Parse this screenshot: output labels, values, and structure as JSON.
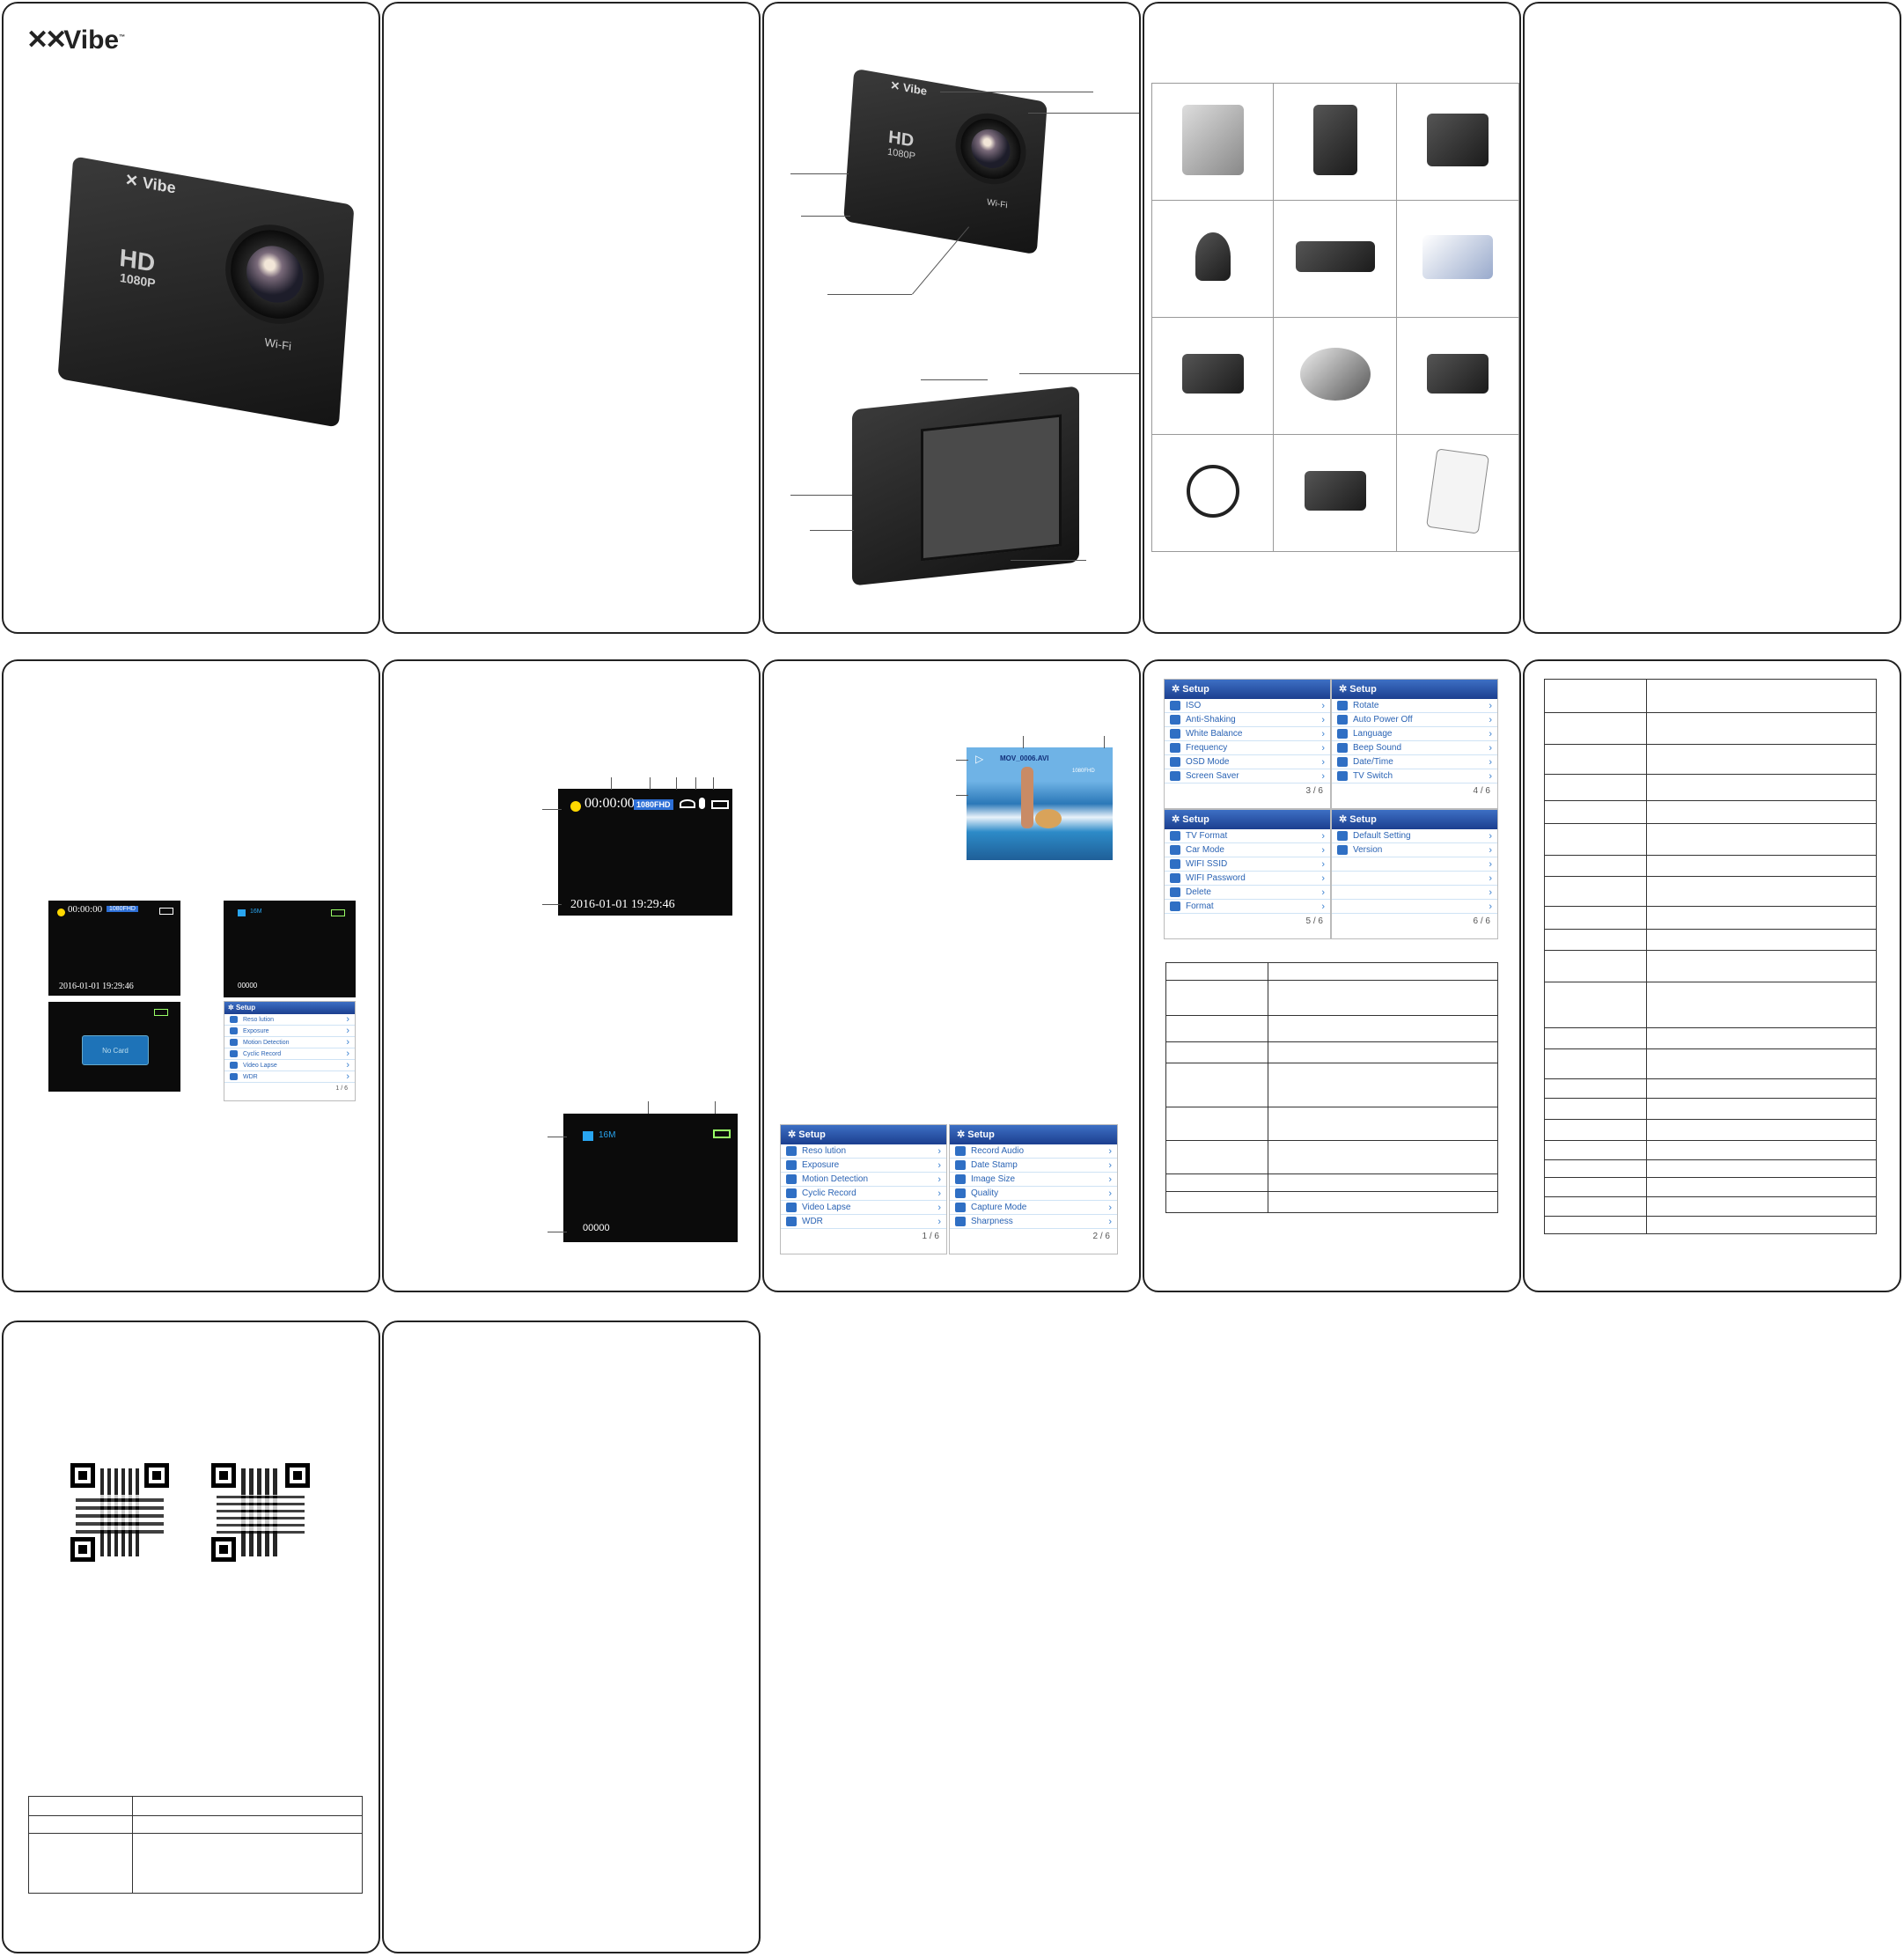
{
  "brand": {
    "name": "Vibe",
    "tm": "™"
  },
  "camera_front": {
    "hd": "HD",
    "res": "1080P",
    "wifi": "Wi-Fi"
  },
  "camera_diagram": {
    "hd": "HD",
    "res": "1080P",
    "wifi": "Wi-Fi"
  },
  "osd_video": {
    "timer": "00:00:00",
    "resolution": "1080FHD",
    "datetime": "2016-01-01  19:29:46"
  },
  "osd_photo": {
    "size": "16M",
    "count": "00000"
  },
  "no_card": {
    "text": "No Card"
  },
  "playback": {
    "filename": "MOV_0006.AVI",
    "res": "1080FHD"
  },
  "setup_title": "Setup",
  "menus": {
    "p1": {
      "items": [
        "Reso lution",
        "Exposure",
        "Motion Detection",
        "Cyclic Record",
        "Video Lapse",
        "WDR"
      ],
      "page": "1 / 6"
    },
    "p2": {
      "items": [
        "Record Audio",
        "Date Stamp",
        "Image Size",
        "Quality",
        "Capture Mode",
        "Sharpness"
      ],
      "page": "2 / 6"
    },
    "p3": {
      "items": [
        "ISO",
        "Anti-Shaking",
        "White Balance",
        "Frequency",
        "OSD Mode",
        "Screen Saver"
      ],
      "page": "3 / 6"
    },
    "p4": {
      "items": [
        "Rotate",
        "Auto Power Off",
        "Language",
        "Beep Sound",
        "Date/Time",
        "TV Switch"
      ],
      "page": "4 / 6"
    },
    "p5": {
      "items": [
        "TV Format",
        "Car Mode",
        "WIFI SSID",
        "WIFI Password",
        "Delete",
        "Format"
      ],
      "page": "5 / 6"
    },
    "p6": {
      "items": [
        "Default Setting",
        "Version",
        "",
        "",
        "",
        ""
      ],
      "page": "6 / 6"
    }
  },
  "colors": {
    "menu_blue": "#1c3f8f",
    "osd_tag": "#2d6fd6",
    "record_dot": "#ffd800"
  },
  "icons": [
    "battery-icon",
    "wifi-icon",
    "camera-icon",
    "qr-code-icon",
    "chevron-right-icon"
  ]
}
